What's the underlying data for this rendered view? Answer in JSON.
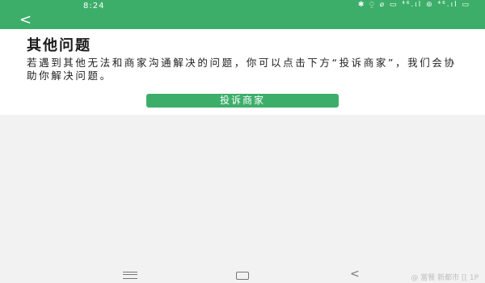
{
  "status_bar": {
    "time": "8:24",
    "icons": "✱ ⍜ ⌀ ▭ ⁴⁶.ıl ⊚ ⁴⁶.ıl ▭"
  },
  "header": {
    "back_icon": "<"
  },
  "page": {
    "title": "其他问题",
    "description": "若遇到其他无法和商家沟通解决的问题，你可以点击下方“投诉商家”，我们会协助你解决问题。",
    "complain_button": "投诉商家"
  },
  "nav_bar": {
    "menu_icon": "menu-icon",
    "home_icon": "home-icon",
    "back_icon": "<"
  },
  "watermark": {
    "text": "@ 富餐 新都市 [[ 1P"
  },
  "colors": {
    "accent": "#3dae6a",
    "background": "#f2f2f2"
  }
}
